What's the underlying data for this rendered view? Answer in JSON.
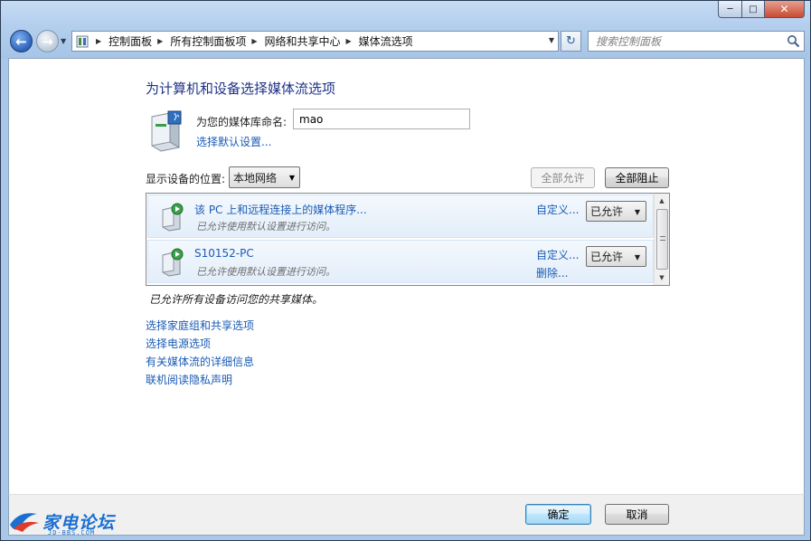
{
  "window": {
    "caption_min": "─",
    "caption_max": "□",
    "caption_close": "✕"
  },
  "nav": {
    "back": "←",
    "forward": "→",
    "recent": "▼"
  },
  "address": {
    "crumbs": [
      "控制面板",
      "所有控制面板项",
      "网络和共享中心",
      "媒体流选项"
    ],
    "separator": "▶",
    "dropdown": "▼",
    "refresh": "↻"
  },
  "search": {
    "placeholder": "搜索控制面板"
  },
  "main": {
    "title": "为计算机和设备选择媒体流选项",
    "library_label": "为您的媒体库命名:",
    "library_value": "mao",
    "default_settings_link": "选择默认设置...",
    "show_devices_label": "显示设备的位置:",
    "location_select": "本地网络",
    "allow_all": "全部允许",
    "block_all": "全部阻止",
    "devices": [
      {
        "name": "该 PC 上和远程连接上的媒体程序...",
        "status": "已允许使用默认设置进行访问。",
        "customize": "自定义...",
        "delete": "",
        "permission": "已允许"
      },
      {
        "name": "S10152-PC",
        "status": "已允许使用默认设置进行访问。",
        "customize": "自定义...",
        "delete": "删除...",
        "permission": "已允许"
      }
    ],
    "status_note": "已允许所有设备访问您的共享媒体。",
    "links": [
      "选择家庭组和共享选项",
      "选择电源选项",
      "有关媒体流的详细信息",
      "联机阅读隐私声明"
    ]
  },
  "footer": {
    "ok": "确定",
    "cancel": "取消"
  },
  "watermark": {
    "text": "家电论坛",
    "sub": "JD-BBS.COM"
  },
  "colors": {
    "link": "#1a5bb5",
    "title": "#1e3287",
    "frame": "#a9c7e8"
  }
}
